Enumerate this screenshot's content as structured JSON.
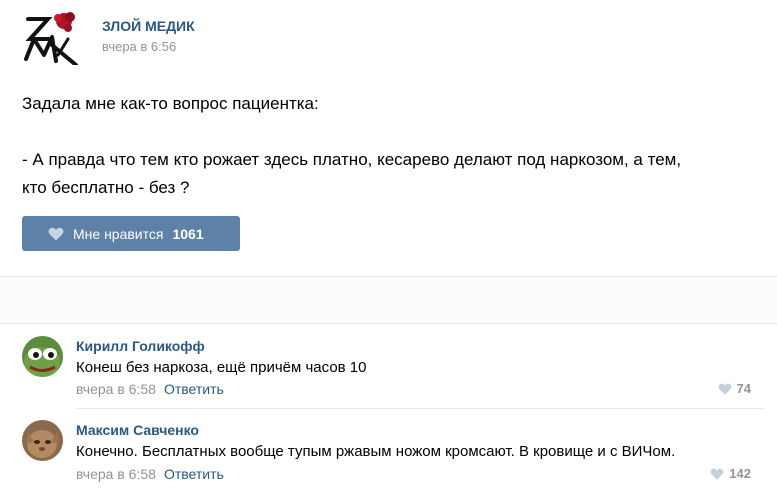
{
  "post": {
    "author": "ЗЛОЙ МЕДИК",
    "time": "вчера в 6:56",
    "text_line1": "Задала мне как-то вопрос пациентка:",
    "text_line2": "- А правда что тем кто рожает здесь платно, кесарево делают под наркозом, а тем,",
    "text_line3": "кто бесплатно - без ?",
    "like_label": "Мне нравится",
    "like_count": "1061",
    "colors": {
      "accent": "#5e81a8",
      "link": "#2a5885",
      "muted": "#939393"
    }
  },
  "comments": [
    {
      "name": "Кирилл Голикофф",
      "text": "Конеш без наркоза, ещё причём часов 10",
      "time": "вчера в 6:58",
      "reply": "Ответить",
      "likes": "74"
    },
    {
      "name": "Максим Савченко",
      "text": "Конечно. Бесплатных вообще тупым ржавым ножом кромсают. В кровище и с ВИЧом.",
      "time": "вчера в 6:58",
      "reply": "Ответить",
      "likes": "142"
    }
  ]
}
